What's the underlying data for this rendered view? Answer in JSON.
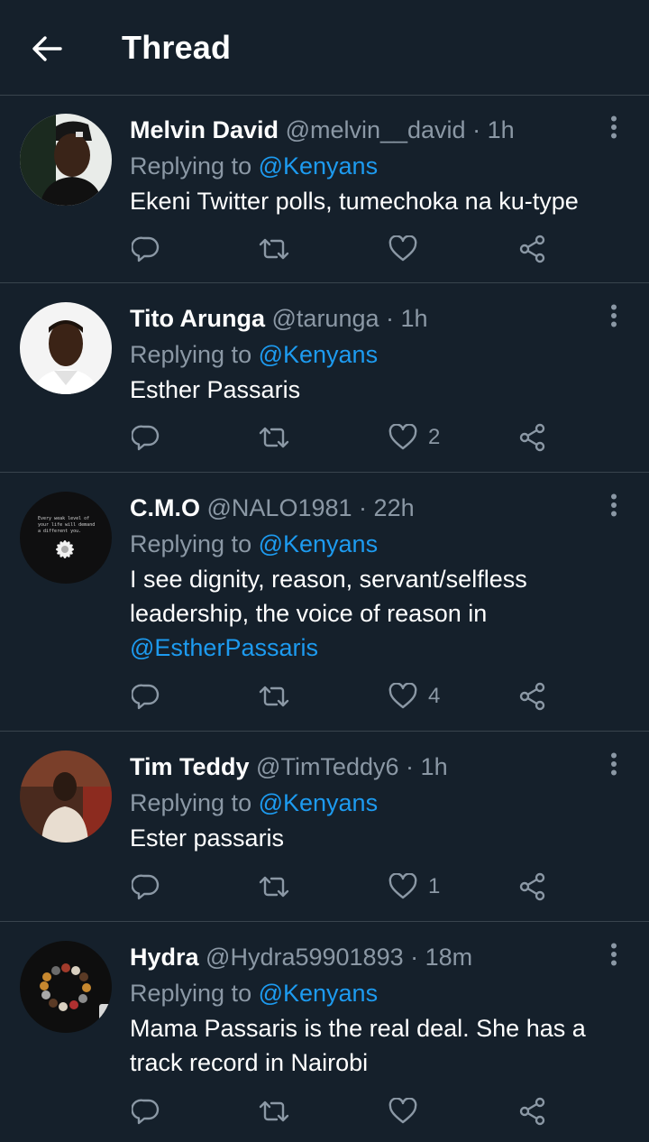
{
  "header": {
    "title": "Thread"
  },
  "tweets": [
    {
      "name": "Melvin David",
      "handle": "@melvin__david",
      "separator": "·",
      "time": "1h",
      "replying_prefix": "Replying to ",
      "replying_to": "@Kenyans",
      "text": "Ekeni Twitter polls, tumechoka na ku-type",
      "likes": ""
    },
    {
      "name": "Tito Arunga",
      "handle": "@tarunga",
      "separator": "·",
      "time": "1h",
      "replying_prefix": "Replying to ",
      "replying_to": "@Kenyans",
      "text": "Esther Passaris",
      "likes": "2"
    },
    {
      "name": "C.M.O",
      "handle": "@NALO1981",
      "separator": "·",
      "time": "22h",
      "replying_prefix": "Replying to ",
      "replying_to": "@Kenyans",
      "text": "I see dignity, reason, servant/selfless leadership, the voice of reason in",
      "text_mention": "@EstherPassaris",
      "likes": "4",
      "avatar_text": [
        "Every weak level of",
        "your life will demand",
        "a different you."
      ]
    },
    {
      "name": "Tim Teddy",
      "handle": "@TimTeddy6",
      "separator": "·",
      "time": "1h",
      "replying_prefix": "Replying to ",
      "replying_to": "@Kenyans",
      "text": "Ester passaris",
      "likes": "1"
    },
    {
      "name": "Hydra",
      "handle": "@Hydra59901893",
      "separator": "·",
      "time": "18m",
      "replying_prefix": "Replying to ",
      "replying_to": "@Kenyans",
      "text": "Mama Passaris is the real deal. She has a track record in Nairobi",
      "likes": ""
    }
  ],
  "colors": {
    "background": "#15202b",
    "divider": "#38444d",
    "secondary_text": "#8b98a5",
    "link": "#1d9bf0"
  },
  "icons": {
    "back": "arrow-left-icon",
    "more": "more-vertical-icon",
    "reply": "reply-bubble-icon",
    "retweet": "retweet-icon",
    "like": "heart-icon",
    "share": "share-icon"
  }
}
